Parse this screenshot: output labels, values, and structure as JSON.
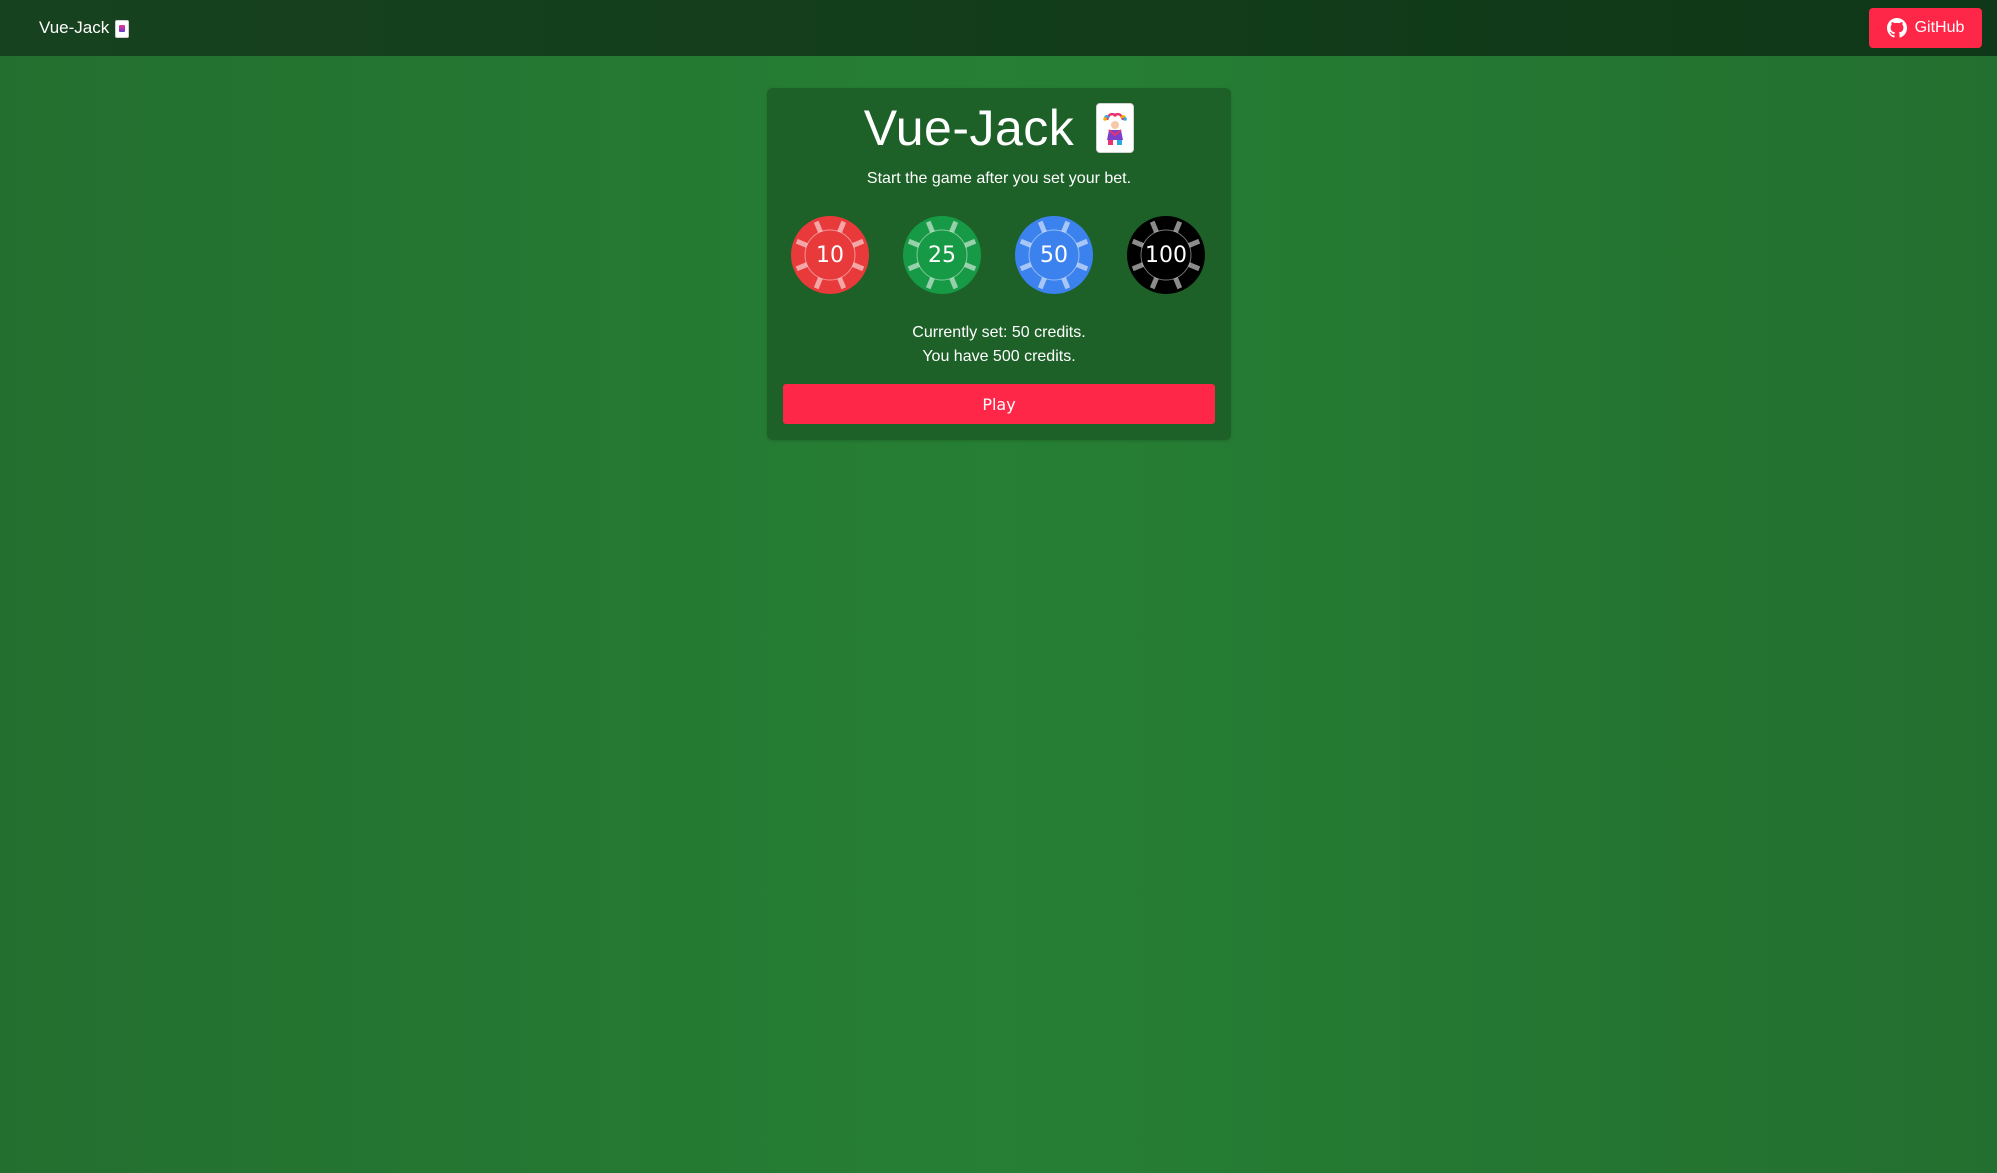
{
  "navbar": {
    "brand_label": "Vue-Jack",
    "brand_icon": "playing-card-icon",
    "github_label": "GitHub",
    "github_icon": "github-icon"
  },
  "panel": {
    "title": "Vue-Jack",
    "title_icon": "joker-card-icon",
    "subtitle": "Start the game after you set your bet."
  },
  "chips": [
    {
      "value": "10",
      "color": "#e83a3a"
    },
    {
      "value": "25",
      "color": "#179a45"
    },
    {
      "value": "50",
      "color": "#3c82ee"
    },
    {
      "value": "100",
      "color": "#000000"
    }
  ],
  "status": {
    "current_bet": "Currently set: 50 credits.",
    "balance": "You have 500 credits."
  },
  "play_label": "Play",
  "colors": {
    "accent": "#ff2748",
    "table_green": "#267f34",
    "panel_green": "#1d6128",
    "navbar": "#123b1a"
  }
}
